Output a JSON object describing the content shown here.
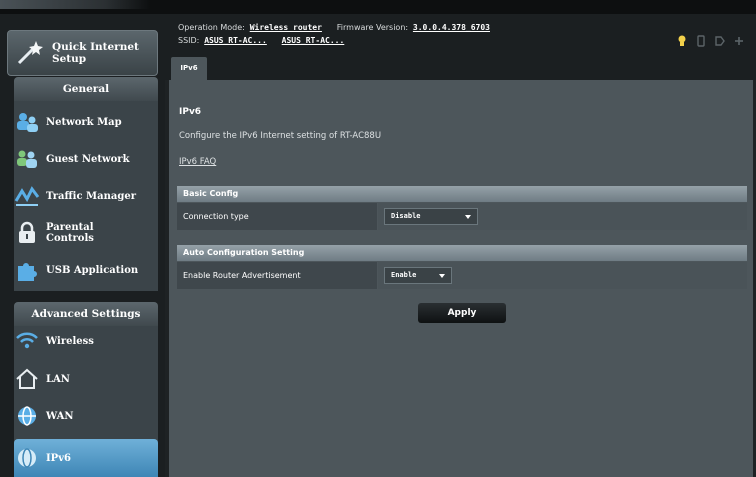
{
  "header": {
    "operation_mode_label": "Operation Mode:",
    "operation_mode_value": "Wireless router",
    "firmware_label": "Firmware Version:",
    "firmware_value": "3.0.0.4.378_6703",
    "ssid_label": "SSID:",
    "ssid_values": [
      "ASUS_RT-AC...",
      "ASUS_RT-AC..."
    ],
    "status_icons": [
      "lightbulb-icon",
      "usb-icon",
      "tag-icon",
      "network-icon"
    ],
    "tab_label": "IPv6"
  },
  "sidebar": {
    "quick_setup_label": "Quick Internet\nSetup",
    "general_label": "General",
    "general_items": [
      {
        "label": "Network Map",
        "icon": "network-map-icon"
      },
      {
        "label": "Guest Network",
        "icon": "guest-network-icon"
      },
      {
        "label": "Traffic Manager",
        "icon": "traffic-manager-icon"
      },
      {
        "label": "Parental\nControls",
        "icon": "lock-icon"
      },
      {
        "label": "USB Application",
        "icon": "puzzle-icon"
      }
    ],
    "advanced_label": "Advanced Settings",
    "advanced_items": [
      {
        "label": "Wireless",
        "icon": "wifi-icon"
      },
      {
        "label": "LAN",
        "icon": "home-icon"
      },
      {
        "label": "WAN",
        "icon": "globe-icon"
      },
      {
        "label": "IPv6",
        "icon": "globe-icon",
        "active": true
      }
    ]
  },
  "main": {
    "title": "IPv6",
    "description": "Configure the IPv6 Internet setting of RT-AC88U",
    "faq_link": "IPv6 FAQ",
    "basic_config": {
      "heading": "Basic Config",
      "connection_type_label": "Connection type",
      "connection_type_value": "Disable"
    },
    "auto_config": {
      "heading": "Auto Configuration Setting",
      "router_adv_label": "Enable Router Advertisement",
      "router_adv_value": "Enable"
    },
    "apply_label": "Apply"
  },
  "colors": {
    "panel": "#4d565b",
    "sidebar": "#1b1f21",
    "active_item": "#3e86b6",
    "section_header": "#7f8b92"
  }
}
